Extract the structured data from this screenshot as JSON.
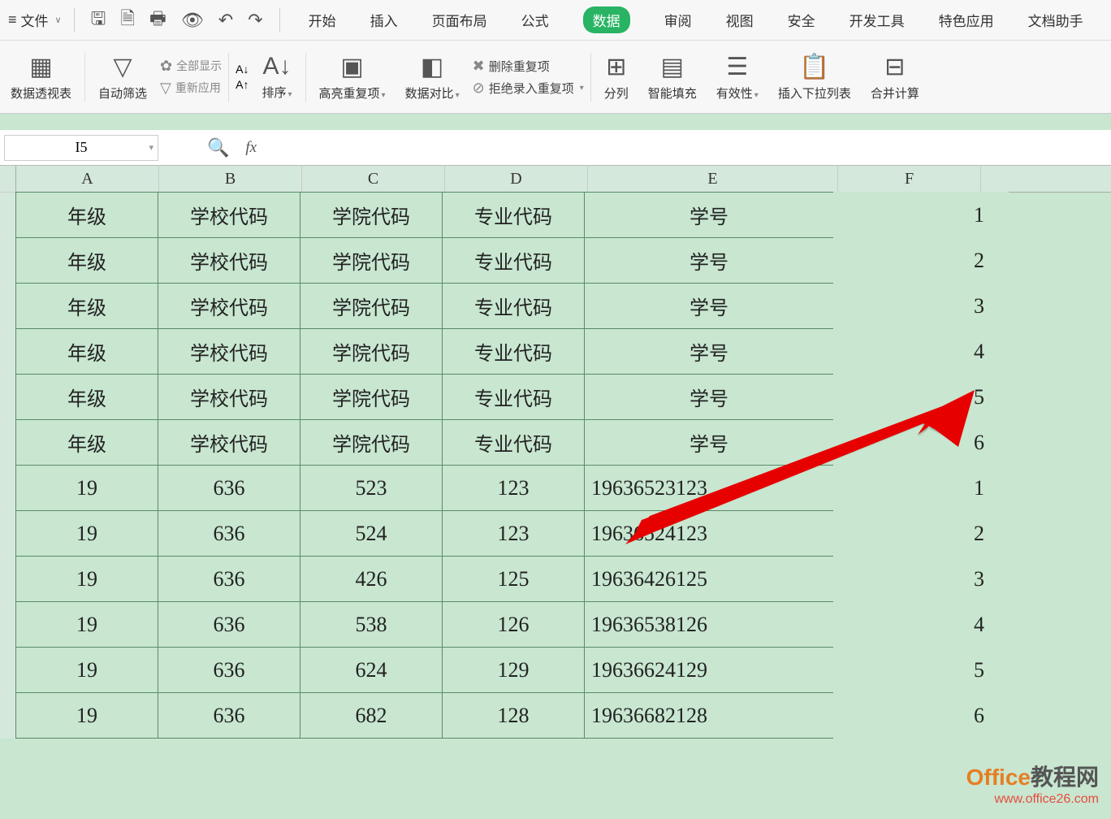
{
  "topbar": {
    "file": "文件"
  },
  "tabs": {
    "start": "开始",
    "insert": "插入",
    "layout": "页面布局",
    "formula": "公式",
    "data": "数据",
    "review": "审阅",
    "view": "视图",
    "security": "安全",
    "dev": "开发工具",
    "special": "特色应用",
    "dochelp": "文档助手"
  },
  "ribbon": {
    "pivot": "数据透视表",
    "autofilter": "自动筛选",
    "showall": "全部显示",
    "reapply": "重新应用",
    "sort": "排序",
    "highlight": "高亮重复项",
    "compare": "数据对比",
    "delDup": "删除重复项",
    "rejectDup": "拒绝录入重复项",
    "split": "分列",
    "smartfill": "智能填充",
    "validation": "有效性",
    "dropdown": "插入下拉列表",
    "consolidate": "合并计算"
  },
  "namebox": "I5",
  "columns": [
    "A",
    "B",
    "C",
    "D",
    "E",
    "F"
  ],
  "headers": {
    "grade": "年级",
    "school": "学校代码",
    "college": "学院代码",
    "major": "专业代码",
    "id": "学号"
  },
  "data_rows": [
    {
      "a": "19",
      "b": "636",
      "c": "523",
      "d": "123",
      "e": "19636523123",
      "f": "1"
    },
    {
      "a": "19",
      "b": "636",
      "c": "524",
      "d": "123",
      "e": "19636524123",
      "f": "2"
    },
    {
      "a": "19",
      "b": "636",
      "c": "426",
      "d": "125",
      "e": "19636426125",
      "f": "3"
    },
    {
      "a": "19",
      "b": "636",
      "c": "538",
      "d": "126",
      "e": "19636538126",
      "f": "4"
    },
    {
      "a": "19",
      "b": "636",
      "c": "624",
      "d": "129",
      "e": "19636624129",
      "f": "5"
    },
    {
      "a": "19",
      "b": "636",
      "c": "682",
      "d": "128",
      "e": "19636682128",
      "f": "6"
    }
  ],
  "header_f": [
    "1",
    "2",
    "3",
    "4",
    "5",
    "6"
  ],
  "watermark": {
    "brand": "Office",
    "suffix": "教程网",
    "url": "www.office26.com"
  }
}
